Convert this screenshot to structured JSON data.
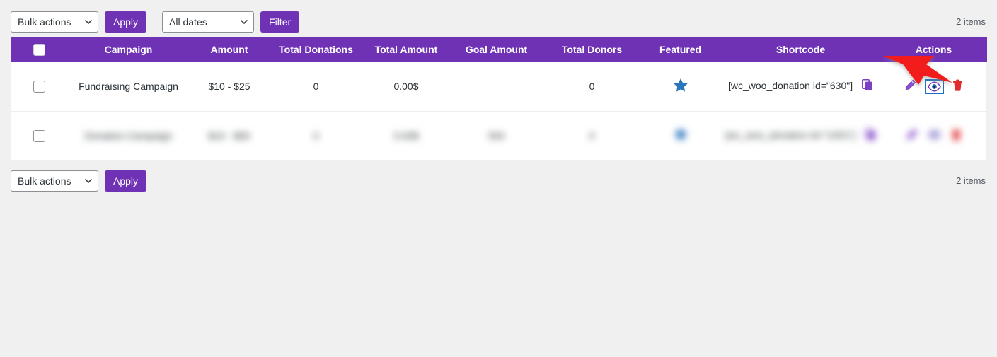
{
  "toolbar_top": {
    "bulk_actions_label": "Bulk actions",
    "apply_label": "Apply",
    "dates_label": "All dates",
    "filter_label": "Filter",
    "items_count": "2 items"
  },
  "toolbar_bottom": {
    "bulk_actions_label": "Bulk actions",
    "apply_label": "Apply",
    "items_count": "2 items"
  },
  "table": {
    "columns": [
      {
        "key": "checkbox",
        "label": ""
      },
      {
        "key": "campaign",
        "label": "Campaign"
      },
      {
        "key": "amount",
        "label": "Amount"
      },
      {
        "key": "total_donations",
        "label": "Total Donations"
      },
      {
        "key": "total_amount",
        "label": "Total Amount"
      },
      {
        "key": "goal_amount",
        "label": "Goal Amount"
      },
      {
        "key": "total_donors",
        "label": "Total Donors"
      },
      {
        "key": "featured",
        "label": "Featured"
      },
      {
        "key": "shortcode",
        "label": "Shortcode"
      },
      {
        "key": "actions",
        "label": "Actions"
      }
    ],
    "rows": [
      {
        "campaign": "Fundraising Campaign",
        "amount": "$10 - $25",
        "total_donations": "0",
        "total_amount": "0.00$",
        "goal_amount": "",
        "total_donors": "0",
        "featured": "star-icon",
        "shortcode": "[wc_woo_donation id=\"630\"]",
        "blurred": false
      },
      {
        "campaign": "Donation Campaign",
        "amount": "$10 - $50",
        "total_donations": "0",
        "total_amount": "0.00$",
        "goal_amount": "500",
        "total_donors": "0",
        "featured": "star-icon",
        "shortcode": "[wc_woo_donation id=\"1001\"]",
        "blurred": true
      }
    ],
    "action_icons": {
      "edit": "pencil-icon",
      "view": "eye-icon",
      "delete": "trash-icon",
      "copy": "copy-icon"
    }
  },
  "colors": {
    "accent_purple": "#6f32b5",
    "page_background": "#f0f0f1",
    "star_blue": "#2a76bd",
    "trash_red": "#e02b2b",
    "highlight_border": "#1a6fc4",
    "annotation_red": "#f21a1a"
  },
  "annotation": {
    "type": "arrow",
    "points_to": "eye-icon",
    "color": "#f21a1a"
  }
}
